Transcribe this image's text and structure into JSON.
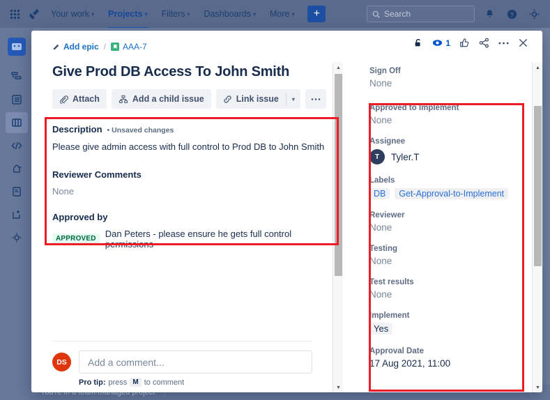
{
  "topnav": {
    "apps_icon": "app-switcher-grid-icon",
    "logo_icon": "jira-logo-icon",
    "items": [
      {
        "label": "Your work",
        "has_caret": true,
        "active": false
      },
      {
        "label": "Projects",
        "has_caret": true,
        "active": true
      },
      {
        "label": "Filters",
        "has_caret": true,
        "active": false
      },
      {
        "label": "Dashboards",
        "has_caret": true,
        "active": false
      },
      {
        "label": "More",
        "has_caret": true,
        "active": false
      }
    ],
    "create_label": "+",
    "search_placeholder": "Search",
    "search_value": "",
    "right_icons": [
      "notifications-bell-icon",
      "help-icon",
      "settings-gear-icon"
    ]
  },
  "sidebar": {
    "items": [
      {
        "name": "project-avatar",
        "icon": "project-avatar-icon"
      },
      {
        "name": "roadmap",
        "icon": "roadmap-icon"
      },
      {
        "name": "backlog",
        "icon": "backlog-icon"
      },
      {
        "name": "board",
        "icon": "board-icon",
        "selected": true
      },
      {
        "name": "code",
        "icon": "code-icon"
      },
      {
        "name": "releases",
        "icon": "releases-icon"
      },
      {
        "name": "pages",
        "icon": "pages-icon"
      },
      {
        "name": "add-item",
        "icon": "add-item-icon"
      },
      {
        "name": "project-settings",
        "icon": "settings-gear-icon"
      }
    ]
  },
  "statusbar": {
    "text": "You're in a team-managed project"
  },
  "modal": {
    "breadcrumb": {
      "add_epic": "Add epic",
      "separator": "/",
      "issue_key": "AAA-7"
    },
    "header_actions": [
      {
        "name": "unlock-icon",
        "label": ""
      },
      {
        "name": "watch-eye-icon",
        "label": "1"
      },
      {
        "name": "thumbs-up-icon",
        "label": ""
      },
      {
        "name": "share-icon",
        "label": ""
      },
      {
        "name": "more-actions-icon",
        "label": ""
      },
      {
        "name": "close-icon",
        "label": ""
      }
    ],
    "title": "Give Prod DB Access To John Smith",
    "action_buttons": {
      "attach": "Attach",
      "add_child": "Add a child issue",
      "link_issue": "Link issue",
      "dropdown_caret": "⌄",
      "more": "•••"
    },
    "fields": [
      {
        "label": "Description",
        "meta": "• Unsaved changes",
        "value": "Please give admin access with full control to Prod DB to John Smith",
        "type": "text"
      },
      {
        "label": "Reviewer Comments",
        "meta": "",
        "value": "None",
        "type": "none"
      },
      {
        "label": "Approved by",
        "meta": "",
        "badge": "APPROVED",
        "value": "Dan Peters - please ensure he gets full control permissions",
        "type": "badge"
      }
    ],
    "comment": {
      "avatar_initials": "DS",
      "placeholder": "Add a comment...",
      "value": "",
      "protip_prefix": "Pro tip:",
      "protip_mid": "press",
      "protip_key": "M",
      "protip_suffix": "to comment"
    },
    "side_fields": [
      {
        "label": "Sign Off",
        "value": "None",
        "type": "none"
      },
      {
        "label": "Approved to Implement",
        "value": "None",
        "type": "none"
      },
      {
        "label": "Assignee",
        "value": "Tyler.T",
        "type": "user",
        "avatar_initials": "T"
      },
      {
        "label": "Labels",
        "type": "chips",
        "chips": [
          "DB",
          "Get-Approval-to-Implement"
        ]
      },
      {
        "label": "Reviewer",
        "value": "None",
        "type": "none"
      },
      {
        "label": "Testing",
        "value": "None",
        "type": "none"
      },
      {
        "label": "Test results",
        "value": "None",
        "type": "none"
      },
      {
        "label": "Implement",
        "value": "Yes",
        "type": "pill"
      },
      {
        "label": "Approval Date",
        "value": "17 Aug 2021, 11:00",
        "type": "text"
      }
    ]
  },
  "annotations": {
    "highlight_color": "#ee1c25",
    "boxes": [
      {
        "name": "description-section-highlight"
      },
      {
        "name": "side-fields-highlight"
      }
    ]
  }
}
